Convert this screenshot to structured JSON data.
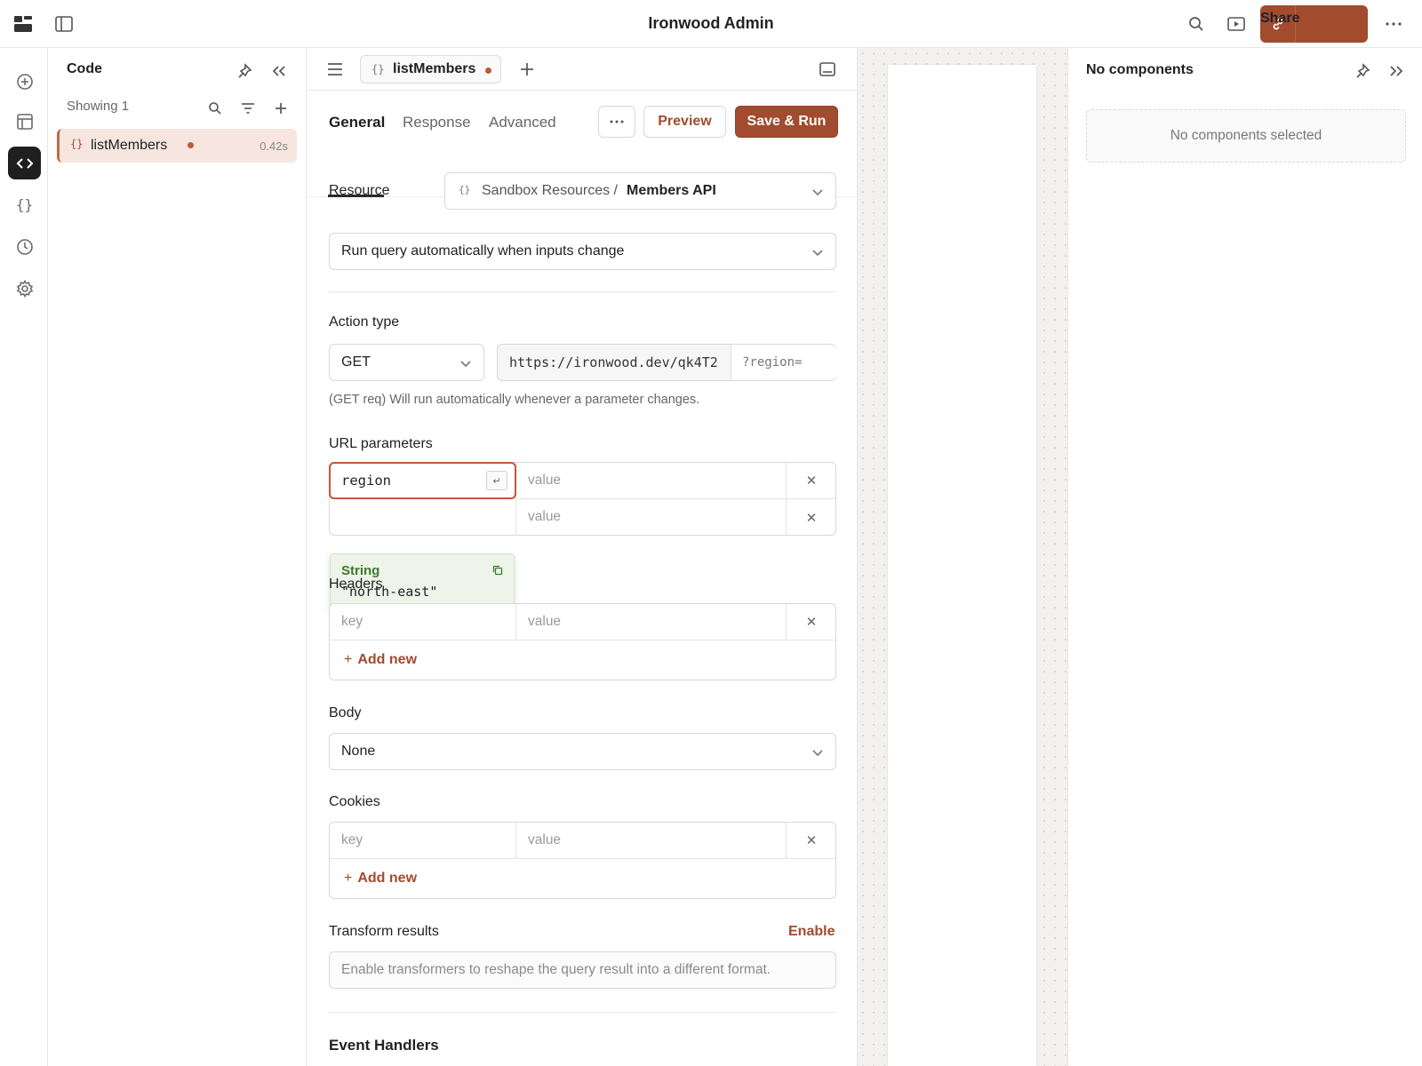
{
  "app": {
    "title": "Ironwood Admin",
    "share_label": "Share"
  },
  "icons": {
    "rail": [
      "add-circle-icon",
      "layout-icon",
      "code-icon",
      "braces-icon",
      "history-icon",
      "settings-icon"
    ]
  },
  "code_panel": {
    "title": "Code",
    "showing": "Showing 1",
    "queries": [
      {
        "name": "listMembers",
        "time": "0.42s"
      }
    ]
  },
  "editor": {
    "file_tab": "listMembers",
    "tabs": [
      "General",
      "Response",
      "Advanced"
    ],
    "preview_label": "Preview",
    "save_run_label": "Save & Run",
    "resource": {
      "label": "Resource",
      "prefix": "Sandbox Resources / ",
      "name": "Members API"
    },
    "run_mode": "Run query automatically when inputs change",
    "action_type": {
      "label": "Action type",
      "method": "GET",
      "url": "https://ironwood.dev/qk4T2",
      "query_suffix": "?region=",
      "help": "(GET req) Will run automatically whenever a parameter changes."
    },
    "url_params": {
      "label": "URL parameters",
      "rows": [
        {
          "key": "region",
          "value_placeholder": "value"
        },
        {
          "key": "",
          "value_placeholder": "value"
        }
      ],
      "popup": {
        "type": "String",
        "value": "\"north-east\""
      }
    },
    "headers": {
      "label": "Headers",
      "key_placeholder": "key",
      "value_placeholder": "value",
      "add_new": "Add new"
    },
    "body": {
      "label": "Body",
      "value": "None"
    },
    "cookies": {
      "label": "Cookies",
      "key_placeholder": "key",
      "value_placeholder": "value",
      "add_new": "Add new"
    },
    "transform": {
      "label": "Transform results",
      "enable": "Enable",
      "placeholder": "Enable transformers to reshape the query result into a different format."
    },
    "event_handlers": "Event Handlers"
  },
  "inspector": {
    "title": "No components",
    "empty": "No components selected"
  },
  "colors": {
    "accent": "#a24b2e",
    "string_green": "#3d7a2c"
  }
}
